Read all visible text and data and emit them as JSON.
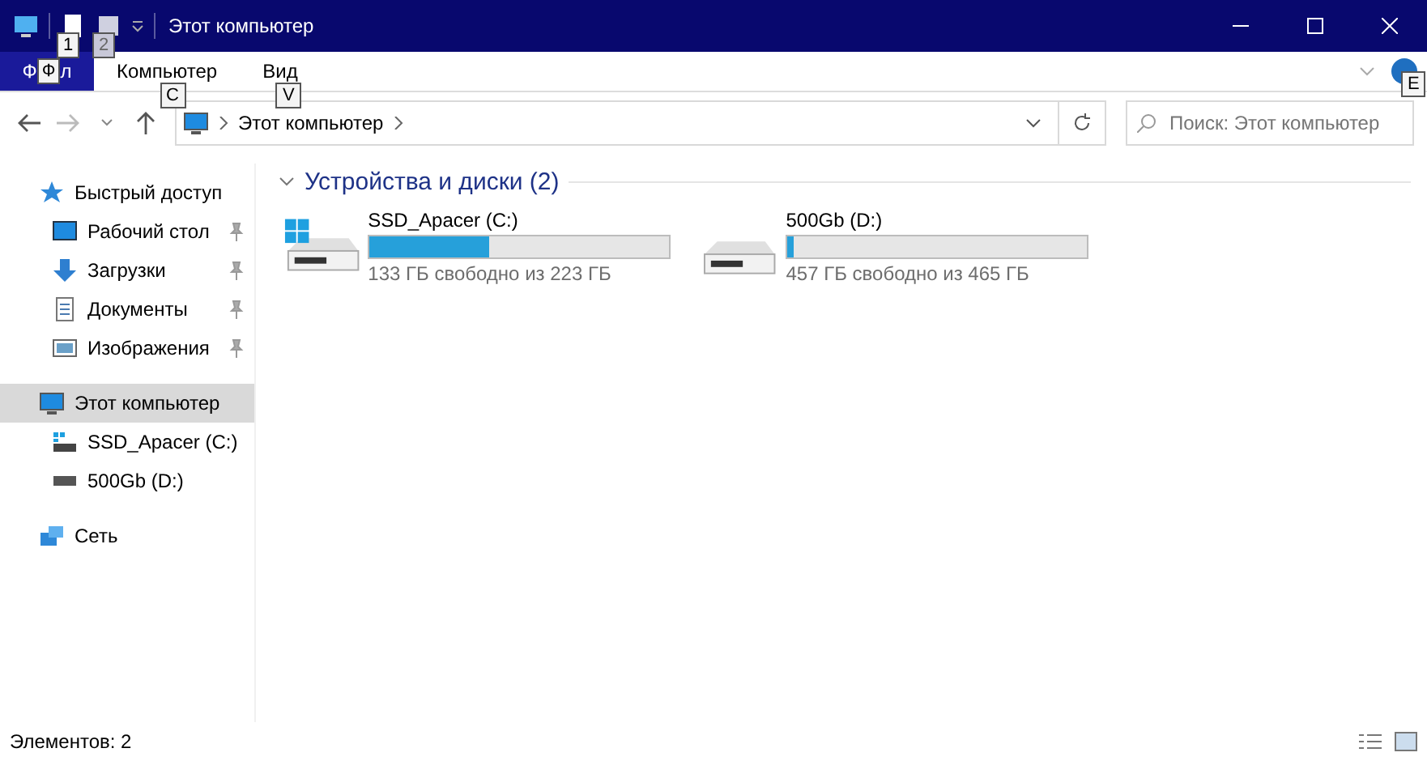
{
  "window": {
    "title": "Этот компьютер",
    "keytips": [
      "1",
      "2"
    ]
  },
  "ribbon": {
    "file_tab": {
      "label_start": "Ф",
      "keytip": "Ф",
      "label_end": "л"
    },
    "tabs": [
      {
        "label": "Компьютер",
        "keytip": "C"
      },
      {
        "label": "Вид",
        "keytip": "V"
      }
    ],
    "help_keytip": "E"
  },
  "address": {
    "path": [
      "Этот компьютер"
    ],
    "search_placeholder": "Поиск: Этот компьютер"
  },
  "sidebar": {
    "items": [
      {
        "label": "Быстрый доступ",
        "selected": false,
        "pinned": false,
        "children": [
          {
            "label": "Рабочий стол",
            "selected": false,
            "pinned": true
          },
          {
            "label": "Загрузки",
            "selected": false,
            "pinned": true
          },
          {
            "label": "Документы",
            "selected": false,
            "pinned": true
          },
          {
            "label": "Изображения",
            "selected": false,
            "pinned": true
          }
        ]
      },
      {
        "label": "Этот компьютер",
        "selected": true,
        "pinned": false,
        "children": [
          {
            "label": "SSD_Apacer (C:)",
            "selected": false,
            "pinned": false
          },
          {
            "label": "500Gb (D:)",
            "selected": false,
            "pinned": false
          }
        ]
      },
      {
        "label": "Сеть",
        "selected": false,
        "pinned": false
      }
    ]
  },
  "group": {
    "title": "Устройства и диски (2)",
    "expanded": true,
    "drives": [
      {
        "name": "SSD_Apacer (C:)",
        "kind": "system",
        "level": 0.4,
        "free": "133 ГБ свободно из 223 ГБ"
      },
      {
        "name": "500Gb (D:)",
        "kind": "plain",
        "level": 0.02,
        "free": "457 ГБ свободно из 465 ГБ"
      }
    ]
  },
  "status_bar": {
    "text": "Элементов: 2"
  }
}
